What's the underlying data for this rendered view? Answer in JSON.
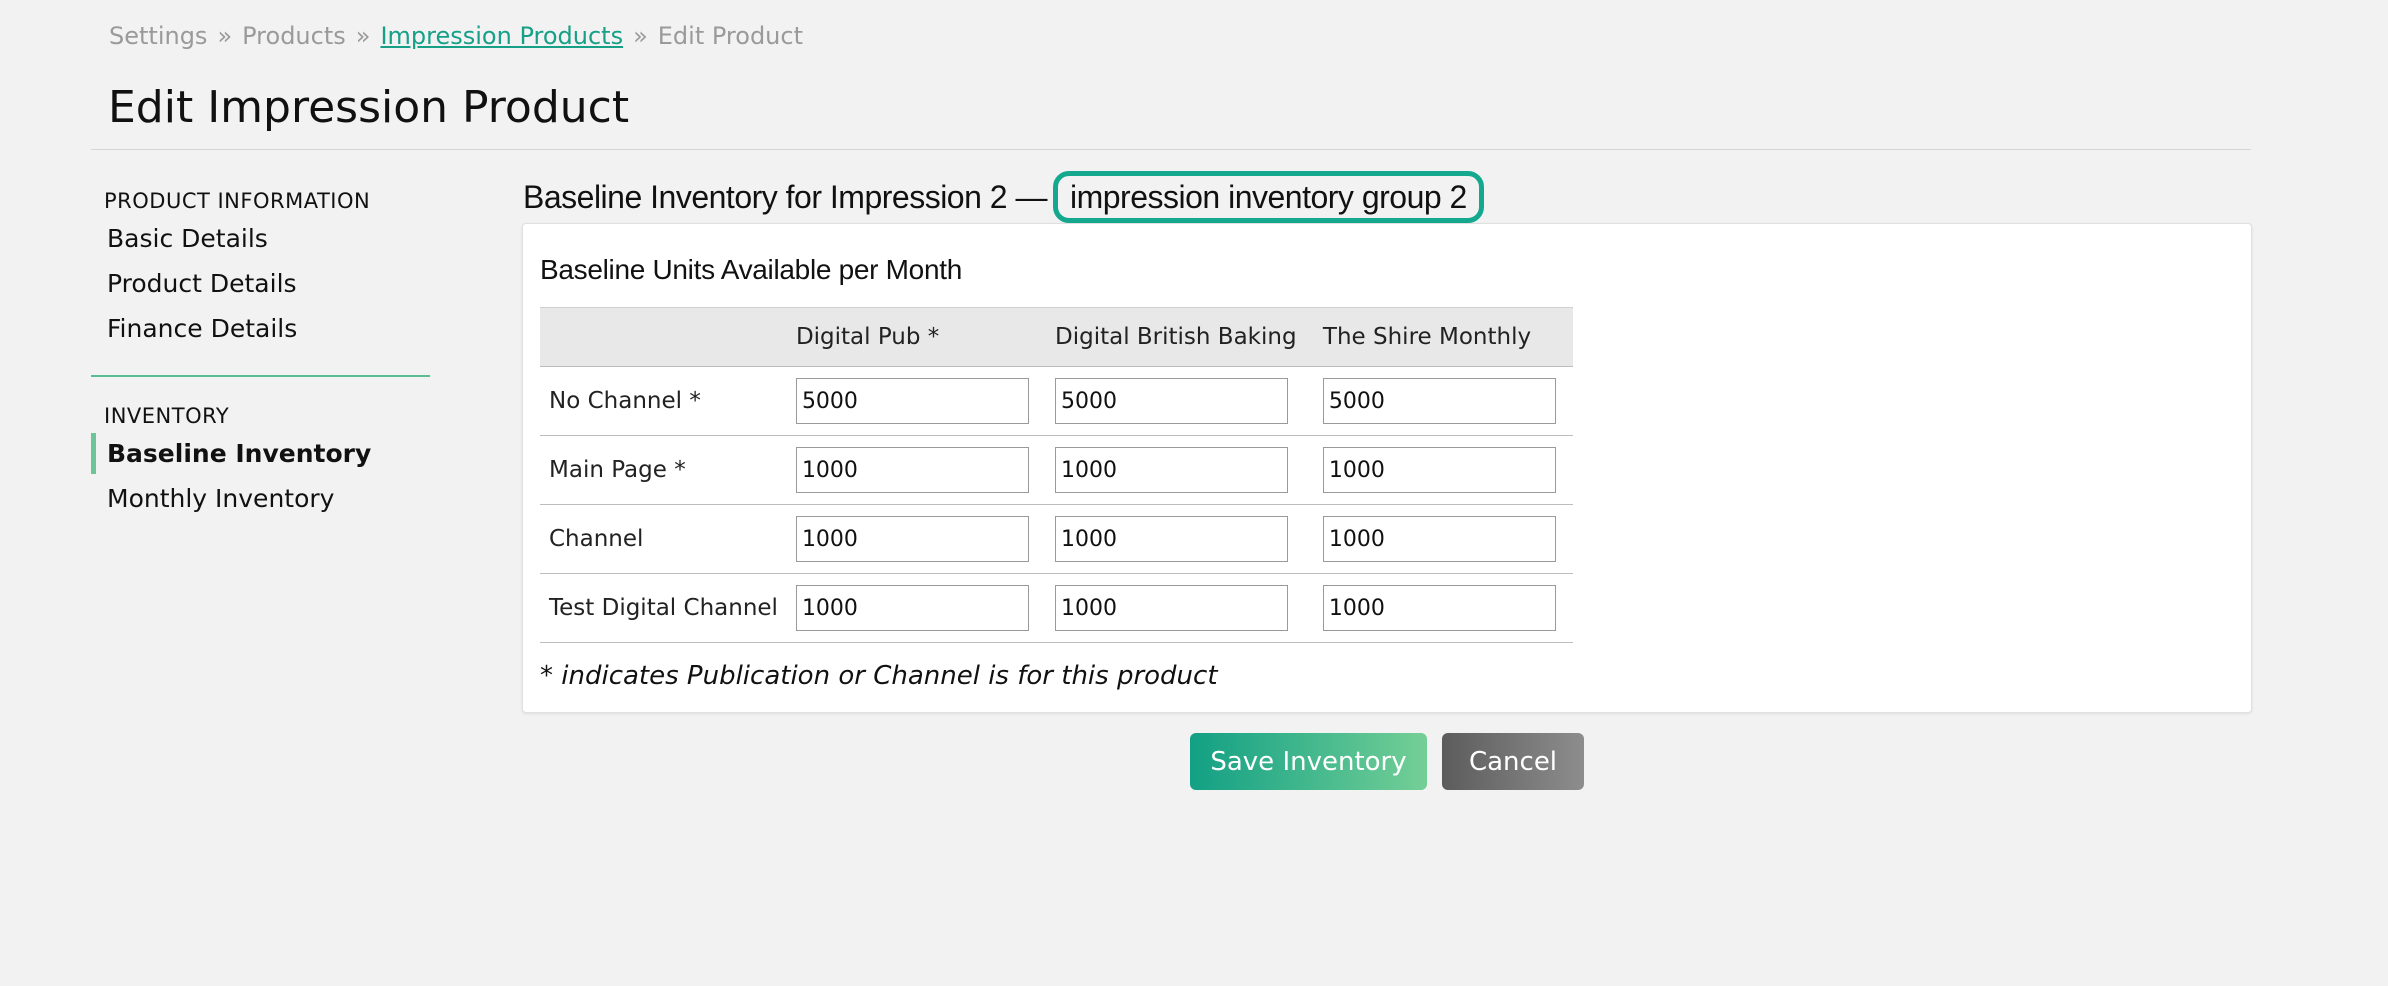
{
  "breadcrumb": {
    "items": [
      {
        "label": "Settings",
        "link": false
      },
      {
        "label": "Products",
        "link": false
      },
      {
        "label": "Impression Products",
        "link": true
      },
      {
        "label": "Edit Product",
        "link": false
      }
    ],
    "separator": "»"
  },
  "page": {
    "title": "Edit Impression Product"
  },
  "sidebar": {
    "sections": [
      {
        "heading": "PRODUCT INFORMATION",
        "items": [
          {
            "label": "Basic Details",
            "active": false
          },
          {
            "label": "Product Details",
            "active": false
          },
          {
            "label": "Finance Details",
            "active": false
          }
        ]
      },
      {
        "heading": "INVENTORY",
        "items": [
          {
            "label": "Baseline Inventory",
            "active": true
          },
          {
            "label": "Monthly Inventory",
            "active": false
          }
        ]
      }
    ]
  },
  "section": {
    "heading_prefix": "Baseline Inventory for Impression 2 —",
    "group_name": "impression inventory group 2"
  },
  "panel": {
    "title": "Baseline Units Available per Month",
    "columns": [
      "",
      "Digital Pub *",
      "Digital British Baking",
      "The Shire Monthly"
    ],
    "rows": [
      {
        "label": "No Channel *",
        "values": [
          "5000",
          "5000",
          "5000"
        ]
      },
      {
        "label": "Main Page *",
        "values": [
          "1000",
          "1000",
          "1000"
        ]
      },
      {
        "label": "Channel",
        "values": [
          "1000",
          "1000",
          "1000"
        ]
      },
      {
        "label": "Test Digital Channel",
        "values": [
          "1000",
          "1000",
          "1000"
        ]
      }
    ],
    "footnote": "* indicates Publication or Channel is for this product"
  },
  "actions": {
    "save_label": "Save Inventory",
    "cancel_label": "Cancel"
  },
  "colors": {
    "accent": "#17a088",
    "highlight_border": "#14a98f",
    "sidebar_active_bar": "#6cc497",
    "background": "#f2f2f2"
  }
}
